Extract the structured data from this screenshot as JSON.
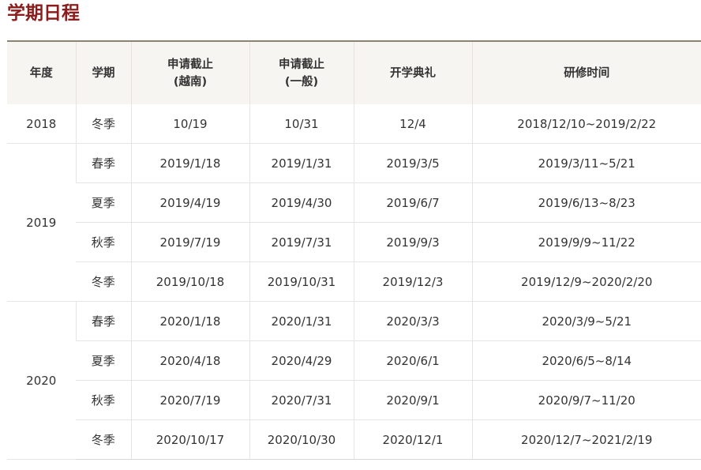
{
  "page": {
    "title": "学期日程"
  },
  "table": {
    "headers": {
      "year": "年度",
      "term": "学期",
      "deadline_vn_line1": "申请截止",
      "deadline_vn_line2": "(越南)",
      "deadline_gen_line1": "申请截止",
      "deadline_gen_line2": "(一般)",
      "opening": "开学典礼",
      "period": "研修时间"
    },
    "years": [
      "2018",
      "2019",
      "2020"
    ],
    "rows": [
      {
        "term": "冬季",
        "deadline_vn": "10/19",
        "deadline_gen": "10/31",
        "opening": "12/4",
        "period": "2018/12/10~2019/2/22"
      },
      {
        "term": "春季",
        "deadline_vn": "2019/1/18",
        "deadline_gen": "2019/1/31",
        "opening": "2019/3/5",
        "period": "2019/3/11~5/21"
      },
      {
        "term": "夏季",
        "deadline_vn": "2019/4/19",
        "deadline_gen": "2019/4/30",
        "opening": "2019/6/7",
        "period": "2019/6/13~8/23"
      },
      {
        "term": "秋季",
        "deadline_vn": "2019/7/19",
        "deadline_gen": "2019/7/31",
        "opening": "2019/9/3",
        "period": "2019/9/9~11/22"
      },
      {
        "term": "冬季",
        "deadline_vn": "2019/10/18",
        "deadline_gen": "2019/10/31",
        "opening": "2019/12/3",
        "period": "2019/12/9~2020/2/20"
      },
      {
        "term": "春季",
        "deadline_vn": "2020/1/18",
        "deadline_gen": "2020/1/31",
        "opening": "2020/3/3",
        "period": "2020/3/9~5/21"
      },
      {
        "term": "夏季",
        "deadline_vn": "2020/4/18",
        "deadline_gen": "2020/4/29",
        "opening": "2020/6/1",
        "period": "2020/6/5~8/14"
      },
      {
        "term": "秋季",
        "deadline_vn": "2020/7/19",
        "deadline_gen": "2020/7/31",
        "opening": "2020/9/1",
        "period": "2020/9/7~11/20"
      },
      {
        "term": "冬季",
        "deadline_vn": "2020/10/17",
        "deadline_gen": "2020/10/30",
        "opening": "2020/12/1",
        "period": "2020/12/7~2021/2/19"
      }
    ]
  }
}
